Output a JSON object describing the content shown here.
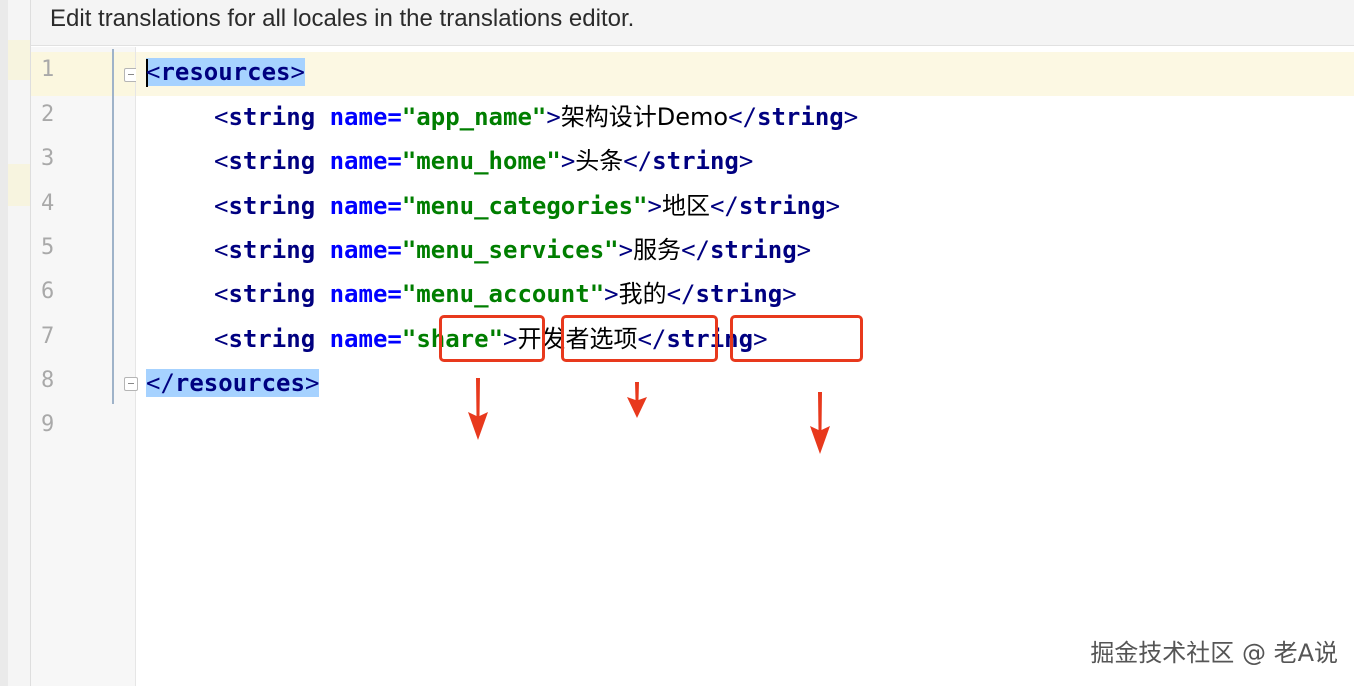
{
  "banner": {
    "text": "Edit translations for all locales in the translations editor."
  },
  "gutter": {
    "line_numbers": [
      "1",
      "2",
      "3",
      "4",
      "5",
      "6",
      "7",
      "8",
      "9"
    ]
  },
  "code": {
    "line1": {
      "open": "<",
      "tag": "resources",
      "close": ">"
    },
    "line2": {
      "open": "<",
      "tag": "string",
      "attr": "name",
      "eq": "=",
      "value": "\"app_name\"",
      "gt": ">",
      "text": "架构设计Demo",
      "end_open": "</",
      "end_tag": "string",
      "end_close": ">"
    },
    "line3": {
      "open": "<",
      "tag": "string",
      "attr": "name",
      "eq": "=",
      "value": "\"menu_home\"",
      "gt": ">",
      "text": "头条",
      "end_open": "</",
      "end_tag": "string",
      "end_close": ">"
    },
    "line4": {
      "open": "<",
      "tag": "string",
      "attr": "name",
      "eq": "=",
      "value": "\"menu_categories\"",
      "gt": ">",
      "text": "地区",
      "end_open": "</",
      "end_tag": "string",
      "end_close": ">"
    },
    "line5": {
      "open": "<",
      "tag": "string",
      "attr": "name",
      "eq": "=",
      "value": "\"menu_services\"",
      "gt": ">",
      "text": "服务",
      "end_open": "</",
      "end_tag": "string",
      "end_close": ">"
    },
    "line6": {
      "open": "<",
      "tag": "string",
      "attr": "name",
      "eq": "=",
      "value": "\"menu_account\"",
      "gt": ">",
      "text": "我的",
      "end_open": "</",
      "end_tag": "string",
      "end_close": ">"
    },
    "line7": {
      "open": "<",
      "tag": "string",
      "attr": "name",
      "eq": "=",
      "q1": "\"",
      "value": "share",
      "q2": "\"",
      "gt": ">",
      "text": "开发者选项",
      "end_open": "</",
      "end_tag": "string",
      "end_close": ">"
    },
    "line8": {
      "open": "</",
      "tag": "resources",
      "close": ">"
    }
  },
  "annotation": {
    "color": "#e8391d"
  },
  "watermark": {
    "text": "掘金技术社区 @ 老A说"
  }
}
